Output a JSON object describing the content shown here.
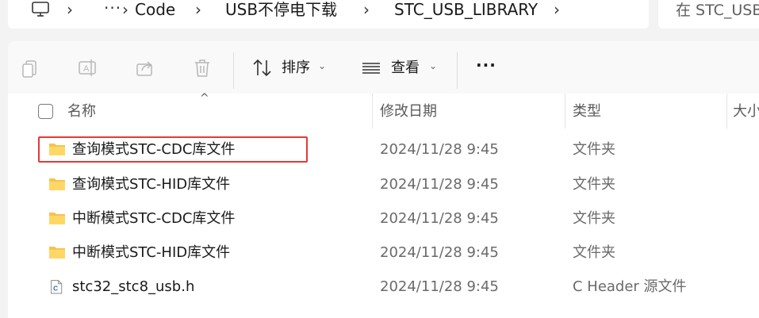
{
  "address_bar": {
    "crumbs": [
      "Code",
      "USB不停电下载",
      "STC_USB_LIBRARY"
    ],
    "more": "···",
    "separator": "›"
  },
  "search": {
    "placeholder": "在 STC_USB"
  },
  "toolbar": {
    "sort_label": "排序",
    "view_label": "查看",
    "more_label": "···",
    "caret": "⌄"
  },
  "columns": {
    "name": "名称",
    "modified": "修改日期",
    "type": "类型",
    "size": "大小"
  },
  "files": [
    {
      "name": "查询模式STC-CDC库文件",
      "modified": "2024/11/28 9:45",
      "type": "文件夹",
      "kind": "folder",
      "highlighted": true
    },
    {
      "name": "查询模式STC-HID库文件",
      "modified": "2024/11/28 9:45",
      "type": "文件夹",
      "kind": "folder"
    },
    {
      "name": "中断模式STC-CDC库文件",
      "modified": "2024/11/28 9:45",
      "type": "文件夹",
      "kind": "folder"
    },
    {
      "name": "中断模式STC-HID库文件",
      "modified": "2024/11/28 9:45",
      "type": "文件夹",
      "kind": "folder"
    },
    {
      "name": "stc32_stc8_usb.h",
      "modified": "2024/11/28 9:45",
      "type": "C Header 源文件",
      "kind": "c-header"
    }
  ],
  "colors": {
    "folder": "#f4c44e",
    "highlight": "#e53935"
  }
}
